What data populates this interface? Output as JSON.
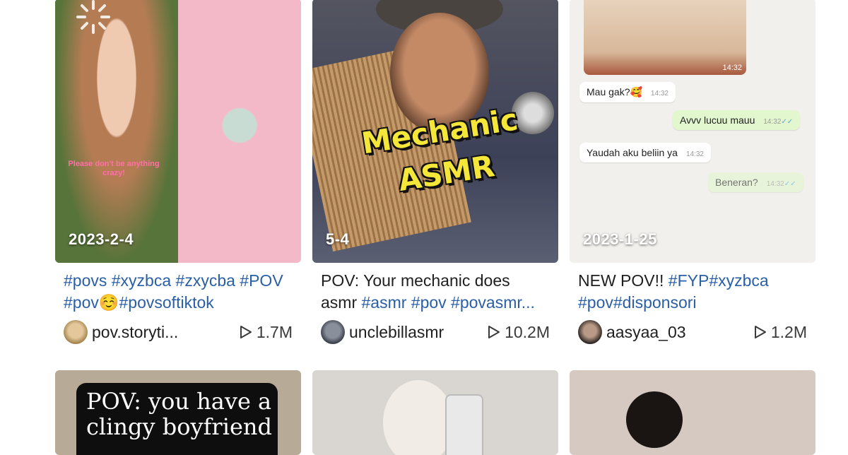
{
  "row1": [
    {
      "date": "2023-2-4",
      "overlay_text": "Please don't be anything crazy!",
      "caption": [
        {
          "text": "#povs #xyzbca #zxycba #POV #pov",
          "tag": true
        },
        {
          "text": "☺️",
          "tag": false
        },
        {
          "text": "#povsoftiktok",
          "tag": true
        }
      ],
      "username": "pov.storyti...",
      "views": "1.7M"
    },
    {
      "date": "5-4",
      "overlay_title": "Mechanic ASMR",
      "caption": [
        {
          "text": "POV: Your mechanic does asmr ",
          "tag": false
        },
        {
          "text": "#asmr #pov #povasmr...",
          "tag": true
        }
      ],
      "username": "unclebillasmr",
      "views": "10.2M"
    },
    {
      "date": "2023-1-25",
      "image_time": "14:32",
      "messages": [
        {
          "text": "Mau gak?🥰",
          "time": "14:32",
          "me": false
        },
        {
          "text": "Avvv lucuu mauu",
          "time": "14:32",
          "me": true
        },
        {
          "text": "Yaudah aku beliin ya",
          "time": "14:32",
          "me": false
        },
        {
          "text": "Beneran?",
          "time": "14:32",
          "me": true
        }
      ],
      "caption": [
        {
          "text": "NEW POV!! ",
          "tag": false
        },
        {
          "text": "#FYP#xyzbca #pov#disponsori",
          "tag": true
        }
      ],
      "username": "aasyaa_03",
      "views": "1.2M"
    }
  ],
  "row2": [
    {
      "overlay_text": "POV: you have a clingy boyfriend"
    },
    {},
    {}
  ],
  "colors": {
    "hashtag": "#2a5fa6",
    "text": "#1f1f1f",
    "overlay_title": "#f5e63a"
  }
}
